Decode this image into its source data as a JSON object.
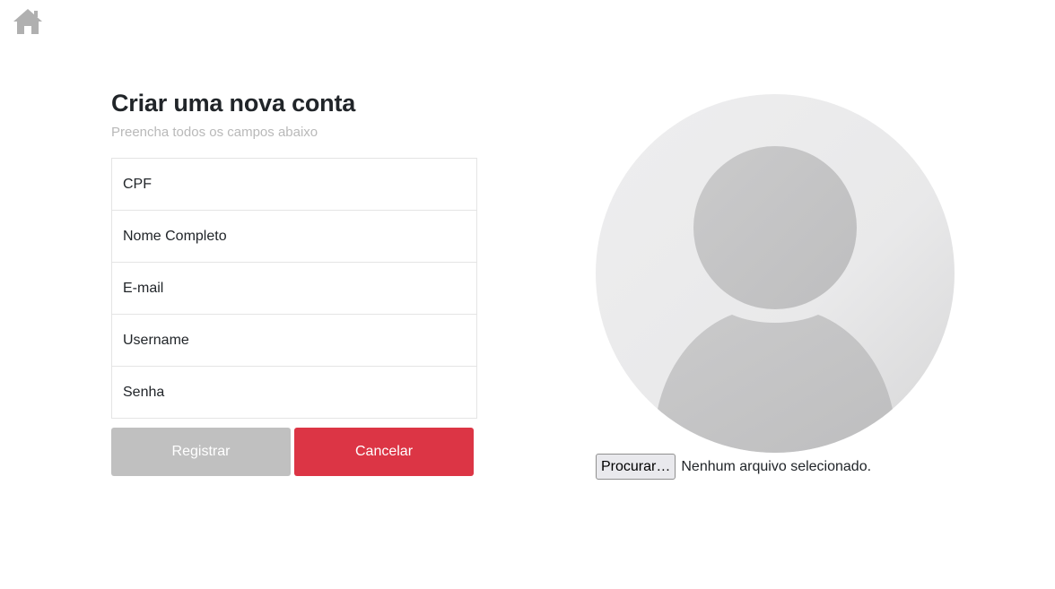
{
  "nav": {
    "home_icon": "home-icon",
    "home_color": "#b0b0b0"
  },
  "form": {
    "title": "Criar uma nova conta",
    "subtitle": "Preencha todos os campos abaixo",
    "fields": {
      "cpf_placeholder": "CPF",
      "fullname_placeholder": "Nome Completo",
      "email_placeholder": "E-mail",
      "username_placeholder": "Username",
      "password_placeholder": "Senha"
    },
    "buttons": {
      "register_label": "Registrar",
      "cancel_label": "Cancelar"
    }
  },
  "avatar": {
    "icon": "user-avatar-placeholder-icon",
    "upload_button_label": "Procurar…",
    "upload_status": "Nenhum arquivo selecionado."
  },
  "colors": {
    "register_button": "#c0c0c0",
    "cancel_button": "#dc3545",
    "subtitle_text": "#b9b9b9",
    "field_border": "#e4e4e4"
  }
}
